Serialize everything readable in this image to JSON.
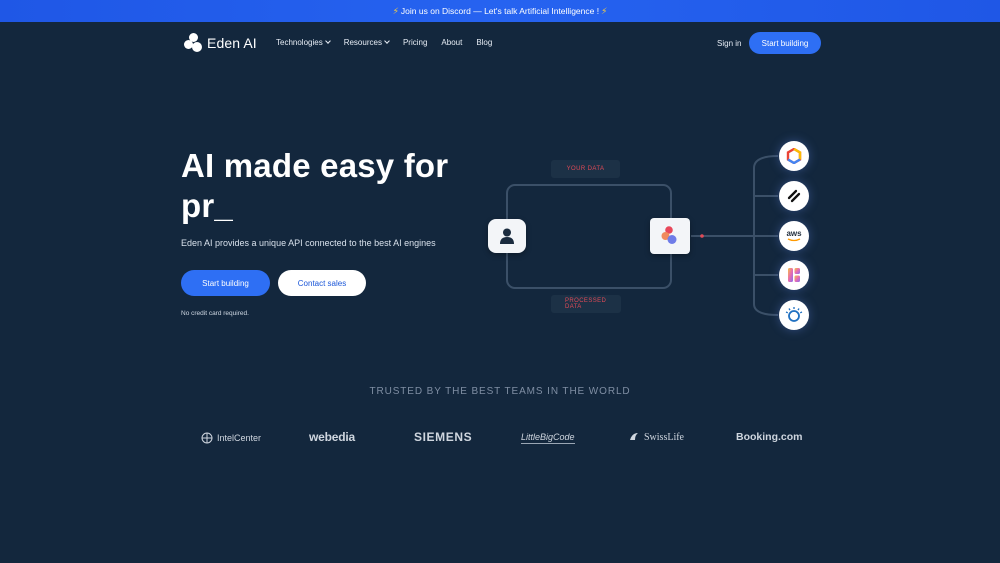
{
  "announcement": {
    "text": "Join us on Discord — Let's talk Artificial Intelligence !",
    "bolt": "⚡"
  },
  "nav": {
    "brand": "Eden AI",
    "links": [
      "Technologies",
      "Resources",
      "Pricing",
      "About",
      "Blog"
    ],
    "sign_in": "Sign in",
    "cta": "Start building"
  },
  "hero": {
    "title_line1": "AI made easy for",
    "title_line2": "pr_",
    "subtitle": "Eden AI provides a unique API connected to the best AI engines",
    "primary_button": "Start building",
    "secondary_button": "Contact sales",
    "note": "No credit card required."
  },
  "diagram": {
    "input_label": "YOUR DATA",
    "output_label": "PROCESSED DATA",
    "providers": [
      "google-cloud-icon",
      "provider-slash-icon",
      "aws-icon",
      "provider-gradient-icon",
      "ibm-watson-icon"
    ],
    "aws_label": "aws",
    "accent_line": "#3b5068",
    "label_color": "#e04a57"
  },
  "trusted": {
    "heading": "TRUSTED BY THE BEST TEAMS IN THE WORLD",
    "companies": [
      "IntelCenter",
      "webedia",
      "SIEMENS",
      "LittleBigCode",
      "SwissLife",
      "Booking.com"
    ]
  },
  "colors": {
    "background": "#13273d",
    "primary": "#2e6ff4",
    "banner": "#2663f0"
  }
}
